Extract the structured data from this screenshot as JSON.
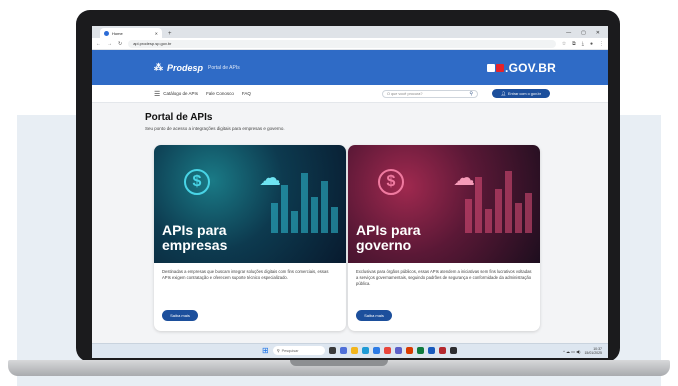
{
  "browser": {
    "tab_title": "Home",
    "tab_close": "✕",
    "new_tab": "+",
    "url": "api.prodesp.sp.gov.br",
    "window_controls": [
      "—",
      "▢",
      "✕"
    ]
  },
  "header": {
    "brand_name": "Prodesp",
    "brand_subtitle": "Portal de APIs",
    "gov_text": "GOV.BR",
    "colors": {
      "primary": "#2f6bc6",
      "dark": "#1c4f9c",
      "gov_red": "#e5232a"
    }
  },
  "nav": {
    "items": [
      "Catálogo de APIs",
      "Fale Conosco",
      "FAQ"
    ],
    "search_placeholder": "O que você procura?",
    "login_label": "Entrar com o gov.br"
  },
  "main": {
    "title": "Portal de APIs",
    "subtitle": "Seu ponto de acesso a integrações digitais para empresas e governo.",
    "cards": [
      {
        "title_line1": "APIs para",
        "title_line2": "empresas",
        "text": "Destinadas a empresas que buscam integrar soluções digitais com fins comerciais, essas APIs exigem contratação e oferecem suporte técnico especializado.",
        "button": "Saiba mais"
      },
      {
        "title_line1": "APIs para",
        "title_line2": "governo",
        "text": "Exclusivas para órgãos públicos, essas APIs atendem a iniciativas sem fins lucrativos voltadas a serviços governamentais, seguindo padrões de segurança e conformidade da administração pública.",
        "button": "Saiba mais"
      }
    ]
  },
  "taskbar": {
    "search_label": "Pesquisar",
    "time": "10:37",
    "date": "15/01/2025",
    "tray": "^ ☁ ▭ ◀)"
  }
}
